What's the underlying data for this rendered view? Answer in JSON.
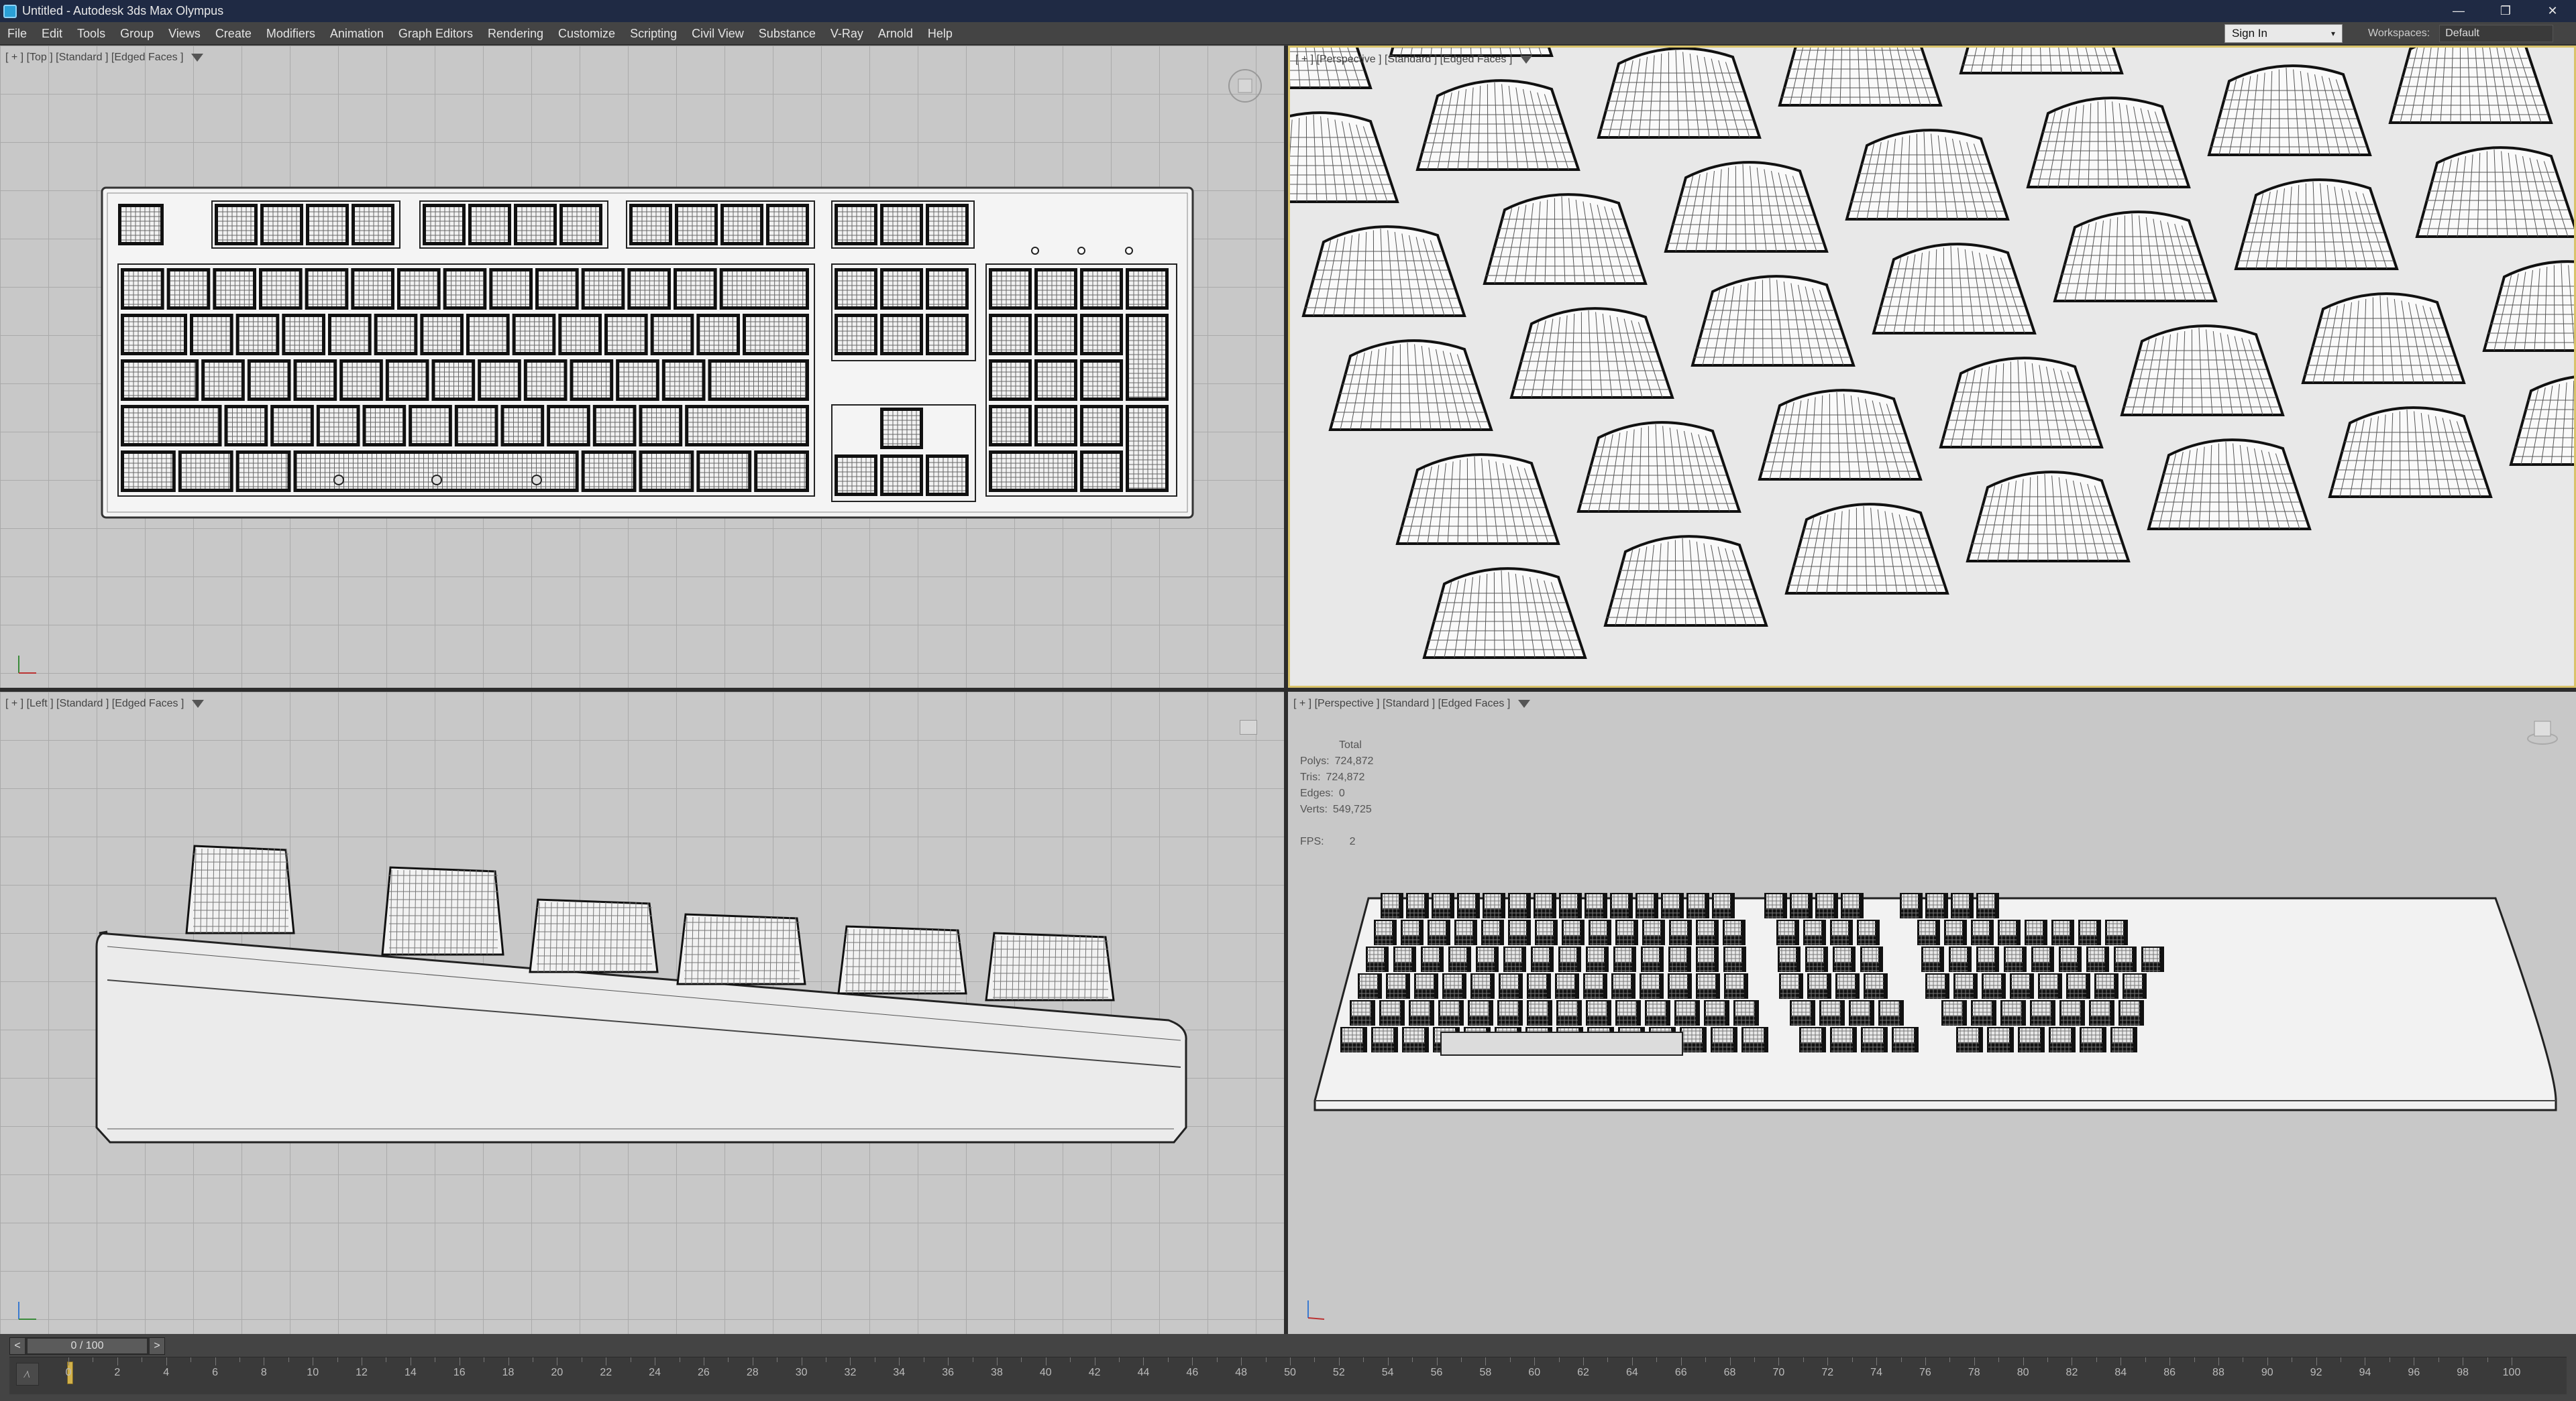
{
  "titlebar": {
    "title": "Untitled - Autodesk 3ds Max Olympus",
    "minimize": "—",
    "restore": "❐",
    "close": "✕"
  },
  "menu": [
    "File",
    "Edit",
    "Tools",
    "Group",
    "Views",
    "Create",
    "Modifiers",
    "Animation",
    "Graph Editors",
    "Rendering",
    "Customize",
    "Scripting",
    "Civil View",
    "Substance",
    "V-Ray",
    "Arnold",
    "Help"
  ],
  "signin": {
    "label": "Sign In",
    "arrow": "▾"
  },
  "workspaces": {
    "label": "Workspaces:",
    "value": "Default"
  },
  "viewports": {
    "top": {
      "label": "[ + ] [Top ] [Standard ] [Edged Faces ]"
    },
    "persp1": {
      "label": "[ + ] [Perspective ] [Standard ] [Edged Faces ]"
    },
    "left": {
      "label": "[ + ] [Left ] [Standard ] [Edged Faces ]"
    },
    "persp2": {
      "label": "[ + ] [Perspective ] [Standard ] [Edged Faces ]"
    }
  },
  "stats": {
    "header": "Total",
    "polys_label": "Polys:",
    "polys_value": "724,872",
    "tris_label": "Tris:",
    "tris_value": "724,872",
    "edges_label": "Edges:",
    "edges_value": "0",
    "verts_label": "Verts:",
    "verts_value": "549,725",
    "fps_label": "FPS:",
    "fps_value": "2"
  },
  "timeslider": {
    "prev": "<",
    "value": "0 / 100",
    "next": ">"
  },
  "timeline": {
    "labels": [
      "0",
      "2",
      "4",
      "6",
      "8",
      "10",
      "12",
      "14",
      "16",
      "18",
      "20",
      "22",
      "24",
      "26",
      "28",
      "30",
      "32",
      "34",
      "36",
      "38",
      "40",
      "42",
      "44",
      "46",
      "48",
      "50",
      "52",
      "54",
      "56",
      "58",
      "60",
      "62",
      "64",
      "66",
      "68",
      "70",
      "72",
      "74",
      "76",
      "78",
      "80",
      "82",
      "84",
      "86",
      "88",
      "90",
      "92",
      "94",
      "96",
      "98",
      "100"
    ]
  },
  "colors": {
    "viewport_bg": "#c8c8c8",
    "grid": "#aaaaaa",
    "ui_dark": "#444444",
    "titlebar": "#1f2a44",
    "active_border": "#d9c36a"
  },
  "icons": {
    "filter": "funnel-icon",
    "nav": "viewcube-icon"
  }
}
